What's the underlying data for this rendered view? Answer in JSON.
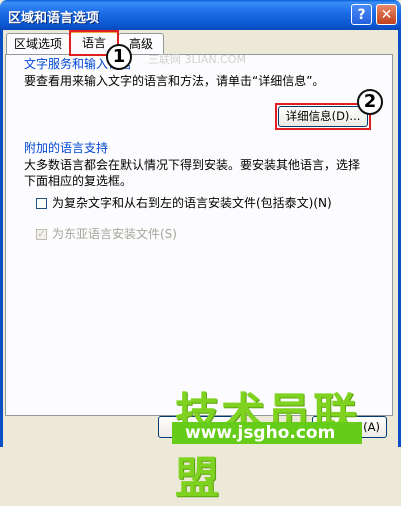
{
  "window": {
    "title": "区域和语言选项",
    "help_label": "?",
    "close_label": "✕"
  },
  "tabs": [
    {
      "label": "区域选项"
    },
    {
      "label": "语言"
    },
    {
      "label": "高级"
    }
  ],
  "text_services": {
    "legend": "文字服务和输入语言",
    "description": "要查看用来输入文字的语言和方法，请单击“详细信息”。",
    "details_button": "详细信息(D)..."
  },
  "supplemental": {
    "legend": "附加的语言支持",
    "description_line1": "大多数语言都会在默认情况下得到安装。要安装其他语言，选择",
    "description_line2": "下面相应的复选框。",
    "complex_script_label": "为复杂文字和从右到左的语言安装文件(包括泰文)(N)",
    "complex_script_checked": false,
    "east_asian_label": "为东亚语言安装文件(S)",
    "east_asian_checked": true
  },
  "markers": [
    "1",
    "2"
  ],
  "bottom_button_label": "(A)",
  "watermark": {
    "brand": "技术员联盟",
    "url": "www.jsgho.com",
    "faint": "三联网 3LIAN.COM"
  },
  "colors": {
    "titlebar": "#0b55d0",
    "legend": "#0046d5",
    "highlight": "#e02020",
    "watermark": "#7fd320"
  }
}
